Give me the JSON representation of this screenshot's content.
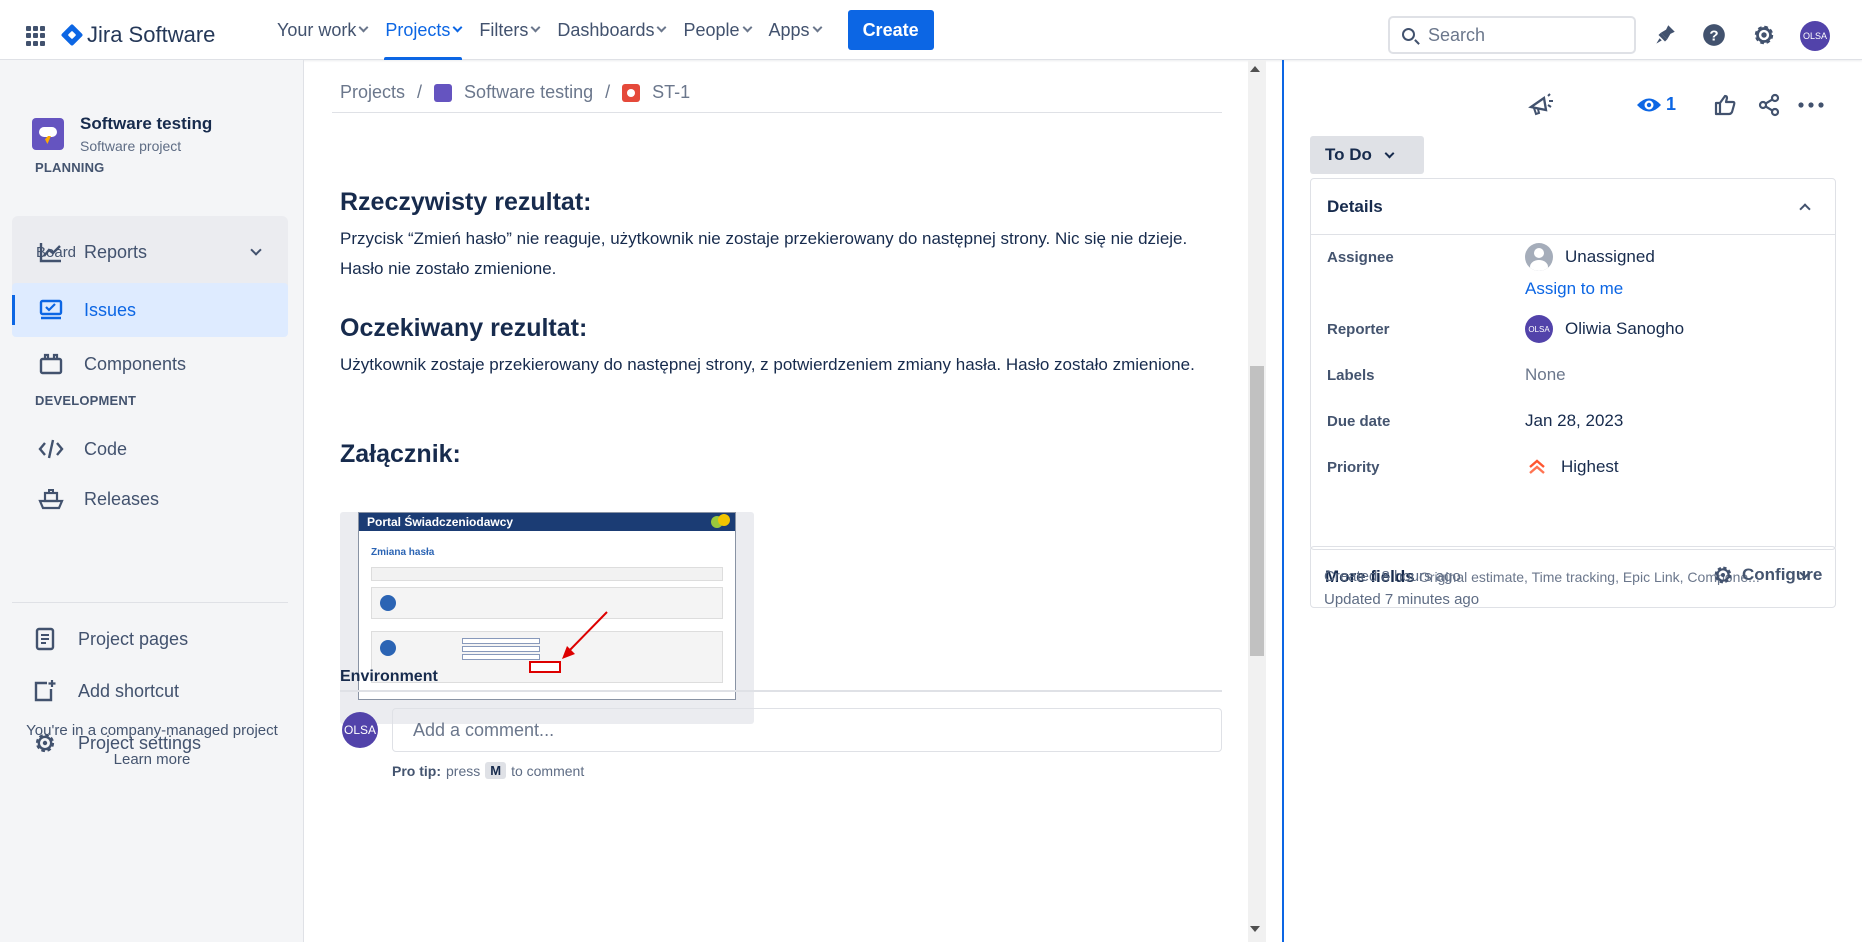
{
  "topnav": {
    "product": "Jira Software",
    "items": [
      {
        "label": "Your work"
      },
      {
        "label": "Projects"
      },
      {
        "label": "Filters"
      },
      {
        "label": "Dashboards"
      },
      {
        "label": "People"
      },
      {
        "label": "Apps"
      }
    ],
    "create_label": "Create",
    "search_placeholder": "Search",
    "avatar_initials": "OLSA"
  },
  "sidebar": {
    "project_name": "Software testing",
    "project_type": "Software project",
    "planning_title": "PLANNING",
    "board_label": "Board",
    "items": {
      "reports": "Reports",
      "issues": "Issues",
      "components": "Components",
      "code": "Code",
      "releases": "Releases",
      "project_pages": "Project pages",
      "add_shortcut": "Add shortcut",
      "project_settings": "Project settings"
    },
    "development_title": "DEVELOPMENT",
    "footer_text": "You're in a company-managed project",
    "learn_more": "Learn more"
  },
  "breadcrumb": {
    "projects": "Projects",
    "project": "Software testing",
    "issue_key": "ST-1",
    "sep": "/"
  },
  "issue": {
    "actual_title": "Rzeczywisty rezultat:",
    "actual_text": "Przycisk “Zmień hasło” nie reaguje, użytkownik nie zostaje przekierowany do następnej strony. Nic się nie dzieje. Hasło nie zostało zmienione.",
    "expected_title": "Oczekiwany rezultat:",
    "expected_text": "Użytkownik zostaje przekierowany do następnej strony, z potwierdzeniem zmiany hasła. Hasło zostało zmienione.",
    "attachment_title": "Załącznik:",
    "attachment_preview": {
      "header": "Portal Świadczeniodawcy",
      "title": "Zmiana hasła",
      "button": "Zmień hasło"
    },
    "environment_label": "Environment",
    "comment_placeholder": "Add a comment...",
    "comment_avatar": "OLSA",
    "protip_bold": "Pro tip:",
    "protip_press": "press",
    "protip_key": "M",
    "protip_rest": "to comment"
  },
  "panel": {
    "watchers": "1",
    "status": "To Do",
    "details_title": "Details",
    "fields": {
      "assignee_label": "Assignee",
      "assignee_value": "Unassigned",
      "assign_to_me": "Assign to me",
      "reporter_label": "Reporter",
      "reporter_value": "Oliwia Sanogho",
      "reporter_initials": "OLSA",
      "labels_label": "Labels",
      "labels_value": "None",
      "due_label": "Due date",
      "due_value": "Jan 28, 2023",
      "priority_label": "Priority",
      "priority_value": "Highest"
    },
    "more_fields_title": "More fields",
    "more_fields_sub": "Original estimate, Time tracking, Epic Link, Compone...",
    "created": "Created 8 hours ago",
    "updated": "Updated 7 minutes ago",
    "configure": "Configure"
  },
  "colors": {
    "brand": "#0C66E4",
    "priority_highest": "#FF5630"
  }
}
